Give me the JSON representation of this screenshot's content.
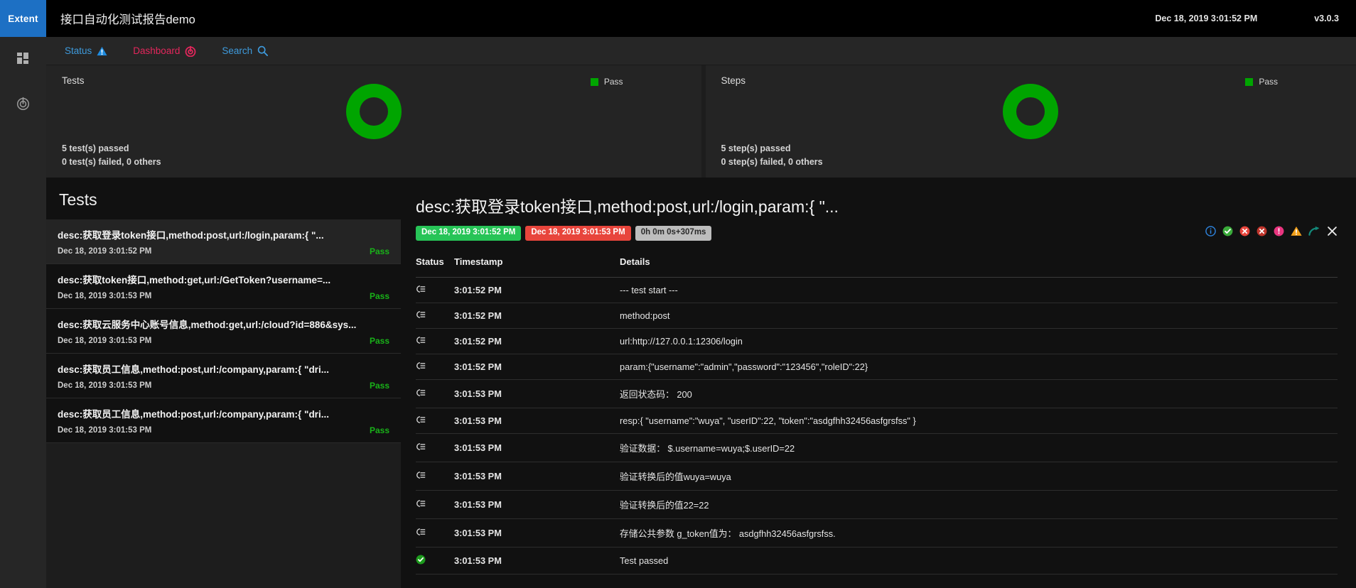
{
  "brand": {
    "label": "Extent"
  },
  "topbar": {
    "title": "接口自动化测试报告demo",
    "timestamp": "Dec 18, 2019 3:01:52 PM",
    "version": "v3.0.3"
  },
  "nav": {
    "items": [
      {
        "label": "Status",
        "icon": "warning-triangle-icon"
      },
      {
        "label": "Dashboard",
        "icon": "dashboard-target-icon"
      },
      {
        "label": "Search",
        "icon": "search-icon"
      }
    ]
  },
  "rail": {
    "items": [
      {
        "name": "grid-icon"
      },
      {
        "name": "target-icon"
      }
    ]
  },
  "cards": [
    {
      "title": "Tests",
      "legend": "Pass",
      "legend_color": "#00a500",
      "passed": "5 test(s) passed",
      "failed": "0 test(s) failed, 0 others"
    },
    {
      "title": "Steps",
      "legend": "Pass",
      "legend_color": "#00a500",
      "passed": "5 step(s) passed",
      "failed": "0 step(s) failed, 0 others"
    }
  ],
  "chart_data": [
    {
      "type": "pie",
      "title": "Tests",
      "labels": [
        "Pass"
      ],
      "values": [
        5
      ],
      "colors": [
        "#00a500"
      ],
      "legend_position": "top-right",
      "annotations": [
        "5 test(s) passed",
        "0 test(s) failed, 0 others"
      ]
    },
    {
      "type": "pie",
      "title": "Steps",
      "labels": [
        "Pass"
      ],
      "values": [
        5
      ],
      "colors": [
        "#00a500"
      ],
      "legend_position": "top-right",
      "annotations": [
        "5 step(s) passed",
        "0 step(s) failed, 0 others"
      ]
    }
  ],
  "list": {
    "header": "Tests",
    "items": [
      {
        "title": "desc:获取登录token接口,method:post,url:/login,param:{ \"...",
        "time": "Dec 18, 2019 3:01:52 PM",
        "status": "Pass",
        "selected": true
      },
      {
        "title": "desc:获取token接口,method:get,url:/GetToken?username=...",
        "time": "Dec 18, 2019 3:01:53 PM",
        "status": "Pass",
        "selected": false
      },
      {
        "title": "desc:获取云服务中心账号信息,method:get,url:/cloud?id=886&sys...",
        "time": "Dec 18, 2019 3:01:53 PM",
        "status": "Pass",
        "selected": false
      },
      {
        "title": "desc:获取员工信息,method:post,url:/company,param:{ \"dri...",
        "time": "Dec 18, 2019 3:01:53 PM",
        "status": "Pass",
        "selected": false
      },
      {
        "title": "desc:获取员工信息,method:post,url:/company,param:{ \"dri...",
        "time": "Dec 18, 2019 3:01:53 PM",
        "status": "Pass",
        "selected": false
      }
    ]
  },
  "detail": {
    "title": "desc:获取登录token接口,method:post,url:/login,param:{ \"...",
    "badge_start": "Dec 18, 2019 3:01:52 PM",
    "badge_end": "Dec 18, 2019 3:01:53 PM",
    "badge_duration": "0h 0m 0s+307ms",
    "icons": [
      {
        "name": "info-icon",
        "color": "#2d7fd6"
      },
      {
        "name": "check-circle-icon",
        "color": "#3aab3a"
      },
      {
        "name": "error-circle-icon",
        "color": "#e8453c"
      },
      {
        "name": "fail-circle-icon",
        "color": "#c0352c"
      },
      {
        "name": "exclamation-circle-icon",
        "color": "#e8357f"
      },
      {
        "name": "warning-triangle-icon",
        "color": "#f2a019"
      },
      {
        "name": "skip-arrow-icon",
        "color": "#13897a"
      },
      {
        "name": "close-icon",
        "color": "#e8e8e8"
      }
    ],
    "table": {
      "columns": [
        "Status",
        "Timestamp",
        "Details"
      ],
      "rows": [
        {
          "status": "log-icon",
          "timestamp": "3:01:52 PM",
          "details": "--- test start ---"
        },
        {
          "status": "log-icon",
          "timestamp": "3:01:52 PM",
          "details": "method:post"
        },
        {
          "status": "log-icon",
          "timestamp": "3:01:52 PM",
          "details": "url:http://127.0.0.1:12306/login"
        },
        {
          "status": "log-icon",
          "timestamp": "3:01:52 PM",
          "details": "param:{\"username\":\"admin\",\"password\":\"123456\",\"roleID\":22}"
        },
        {
          "status": "log-icon",
          "timestamp": "3:01:53 PM",
          "details": "返回状态码： 200"
        },
        {
          "status": "log-icon",
          "timestamp": "3:01:53 PM",
          "details": "resp:{ \"username\":\"wuya\", \"userID\":22, \"token\":\"asdgfhh32456asfgrsfss\" }"
        },
        {
          "status": "log-icon",
          "timestamp": "3:01:53 PM",
          "details": "验证数据： $.username=wuya;$.userID=22"
        },
        {
          "status": "log-icon",
          "timestamp": "3:01:53 PM",
          "details": "验证转换后的值wuya=wuya"
        },
        {
          "status": "log-icon",
          "timestamp": "3:01:53 PM",
          "details": "验证转换后的值22=22"
        },
        {
          "status": "log-icon",
          "timestamp": "3:01:53 PM",
          "details": "存储公共参数 g_token值为： asdgfhh32456asfgrsfss."
        },
        {
          "status": "pass-icon",
          "timestamp": "3:01:53 PM",
          "details": "Test passed"
        }
      ]
    }
  }
}
